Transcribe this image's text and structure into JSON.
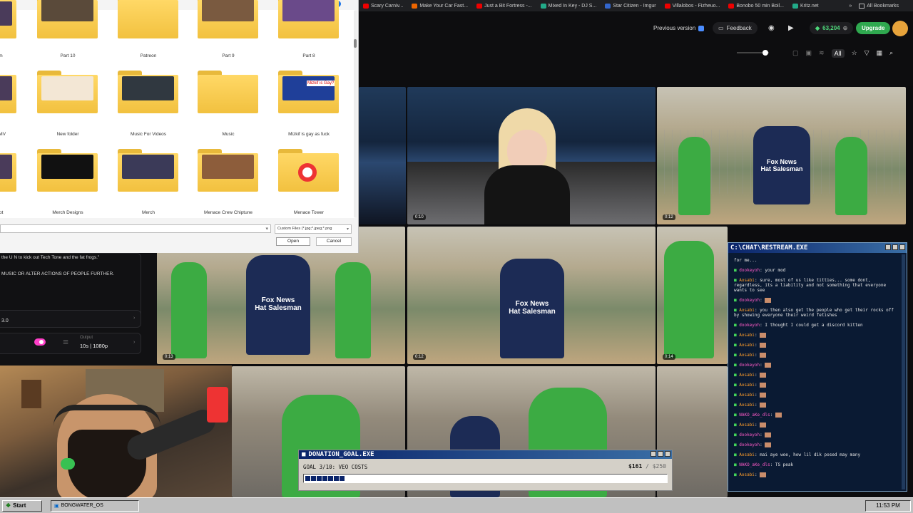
{
  "bookmarks": {
    "items": [
      "Scary Carniv...",
      "Make Your Car Fast...",
      "Just a Bit Fortress -...",
      "Mixed In Key - DJ S...",
      "Star Citizen - Imgur",
      "Villalobos - Fizheuo...",
      "Bonobo 50 min Boil...",
      "Kritz.net"
    ],
    "all_label": "All Bookmarks"
  },
  "app": {
    "previous_version": "Previous version",
    "feedback": "Feedback",
    "credits": "63,204",
    "upgrade": "Upgrade",
    "filter_all": "All",
    "tile_durations": [
      "0:10",
      "0:12",
      "0:13",
      "0:12",
      "0:14"
    ],
    "overlay_shirt_line1": "Fox News",
    "overlay_shirt_line2": "Hat Salesman"
  },
  "dialog": {
    "folders": [
      {
        "label": "Part 10"
      },
      {
        "label": "Patreon"
      },
      {
        "label": "Part 9"
      },
      {
        "label": "Part 8"
      },
      {
        "label": "New folder"
      },
      {
        "label": "Music For Videos"
      },
      {
        "label": "Music"
      },
      {
        "label": "Mizkif is gay as fuck"
      },
      {
        "label": "Merch Designs"
      },
      {
        "label": "Merch"
      },
      {
        "label": "Menace Crew Chiptune"
      },
      {
        "label": "Menace Tower"
      }
    ],
    "partial_labels": [
      "m",
      "AMV",
      "iot"
    ],
    "mizkif_overlay": "Mizkif is Gay?",
    "file_type": "Custom Files (*.jpg;*.jpeg;*.png",
    "open_label": "Open",
    "cancel_label": "Cancel"
  },
  "left_panel": {
    "prompt_line1": "the U N to kick out Tech Tone and the fat frogs.\"",
    "prompt_line2": "MUSIC OR ALTER ACTIONS OF PEOPLE FURTHER.",
    "model": "3.0",
    "output_label": "Output",
    "output_value": "10s | 1080p"
  },
  "chat": {
    "title": "C:\\CHAT\\RESTREAM.EXE",
    "lines": [
      {
        "user": "",
        "text": "for me..."
      },
      {
        "user": "dookeyoh",
        "text": "your mod"
      },
      {
        "user": "Aosabi",
        "text": "sure, most of us like titties... some dont, regardless, its a liability and not something that everyone wants to see"
      },
      {
        "user": "dookeyoh",
        "text": ""
      },
      {
        "user": "Aosabi",
        "text": "you then also get the people who get their rocks off by showing everyone their weird fetishes"
      },
      {
        "user": "dookeyoh",
        "text": "I thought I could get a discord kitten"
      },
      {
        "user": "Aosabi",
        "text": ""
      },
      {
        "user": "Aosabi",
        "text": ""
      },
      {
        "user": "Aosabi",
        "text": ""
      },
      {
        "user": "dookeyoh",
        "text": ""
      },
      {
        "user": "Aosabi",
        "text": ""
      },
      {
        "user": "Aosabi",
        "text": ""
      },
      {
        "user": "Aosabi",
        "text": ""
      },
      {
        "user": "Aosabi",
        "text": ""
      },
      {
        "user": "NAKO_aKe_dls",
        "text": ""
      },
      {
        "user": "Aosabi",
        "text": ""
      },
      {
        "user": "dookeyoh",
        "text": ""
      },
      {
        "user": "dookeyoh",
        "text": ""
      },
      {
        "user": "Aosabi",
        "text": "mai aye woe, how lil dik posed may many"
      },
      {
        "user": "NAKO_aKe_dls",
        "text": "TS peak"
      },
      {
        "user": "Aosabi",
        "text": ""
      }
    ]
  },
  "donation": {
    "title": "DONATION_GOAL.EXE",
    "goal_text": "GOAL 3/10: VEO COSTS",
    "current": "$161",
    "target": "/ $250",
    "progress": 0.644
  },
  "taskbar": {
    "start": "Start",
    "task": "BONGWATER_OS",
    "clock": "11:53 PM"
  },
  "colors": {
    "upgrade": "#2fa84f",
    "credits": "#4ed87a",
    "toggle": "#ff3fc8",
    "titlebar": "#0a246a"
  }
}
